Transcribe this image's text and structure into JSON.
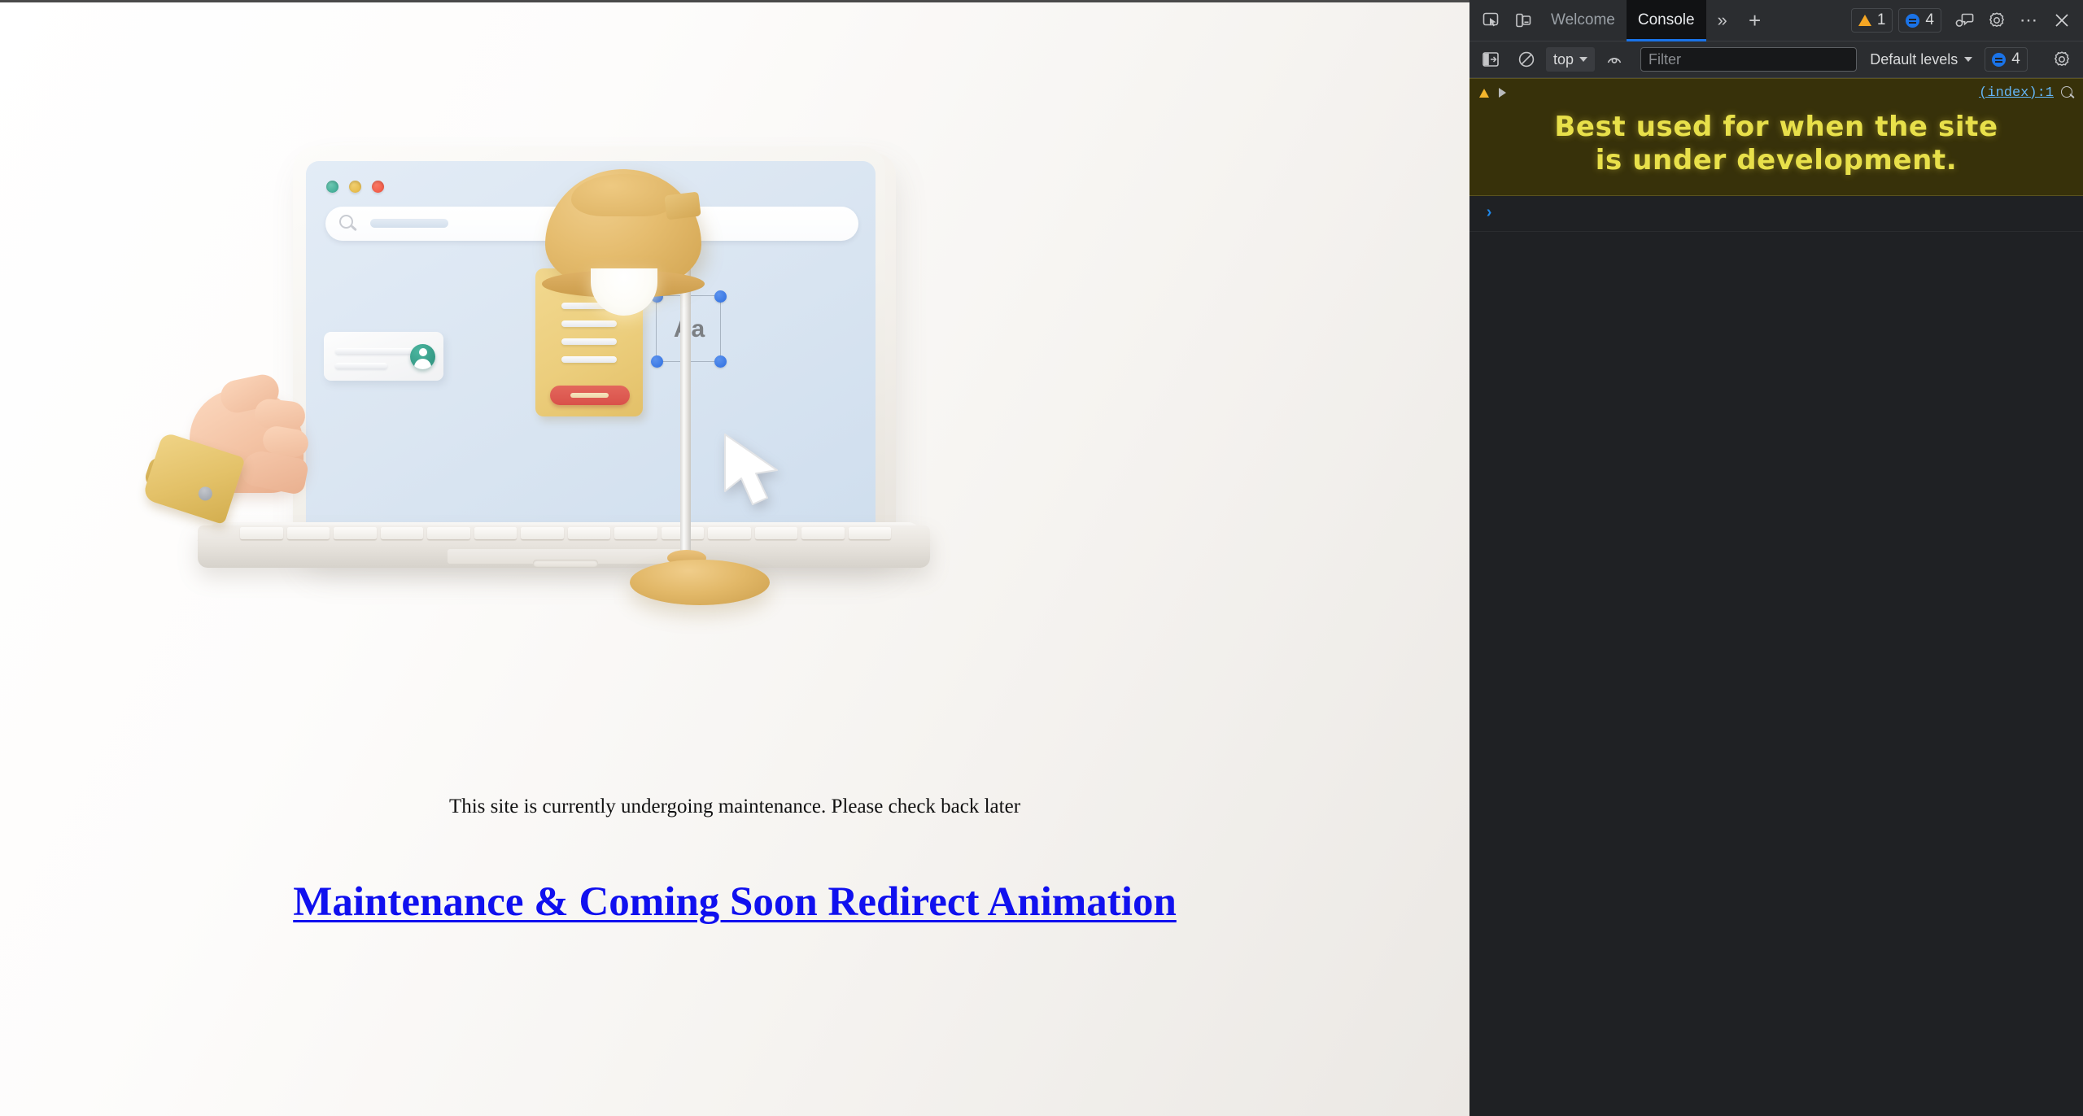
{
  "page": {
    "maintenance_text": "This site is currently undergoing maintenance. Please check back later",
    "link_text": "Maintenance & Coming Soon Redirect Animation",
    "illustration": {
      "selection_label": "Aa",
      "alt": "3d illustration of a laptop with a hand and desk lamp"
    }
  },
  "devtools": {
    "tabs": [
      {
        "label": "Welcome",
        "active": false
      },
      {
        "label": "Console",
        "active": true
      }
    ],
    "more_tabs_label": "»",
    "new_tab_label": "+",
    "warning_count": "1",
    "info_count": "4",
    "console_bar": {
      "context": "top",
      "filter_placeholder": "Filter",
      "filter_value": "",
      "levels_label": "Default levels",
      "levels_count": "4"
    },
    "message": {
      "text": "Best used for when the site is under development.",
      "line1": "Best used for when the site",
      "line2": "is under development.",
      "source": "(index):1",
      "level": "warning"
    },
    "prompt_symbol": "›"
  },
  "colors": {
    "accent_blue": "#1a73e8",
    "warning_orange": "#f5a623",
    "console_warn_bg": "#37310a",
    "console_warn_text": "#e8e04a",
    "link_blue": "#1010ef",
    "devtools_bg": "#1f2124",
    "devtools_toolbar": "#2b2d30"
  }
}
